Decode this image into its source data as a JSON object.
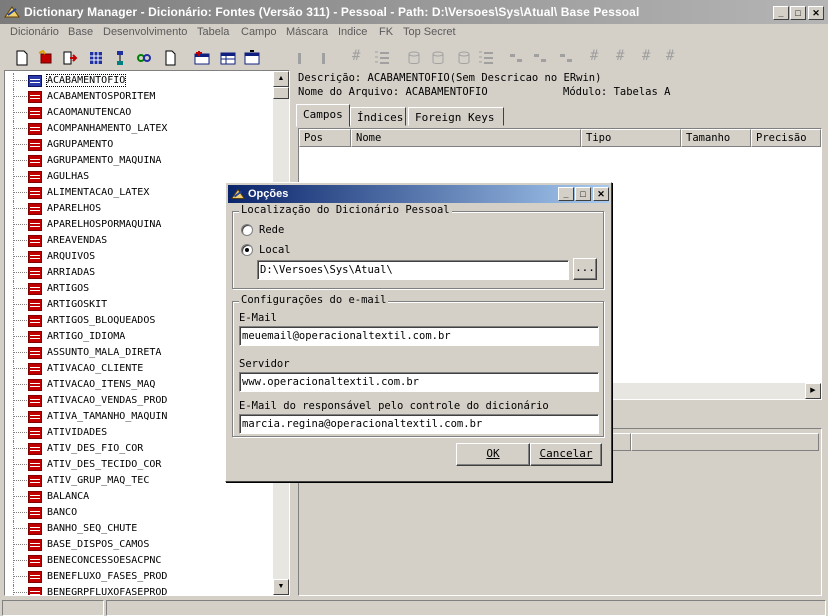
{
  "window": {
    "title": "Dictionary Manager - Dicionário: Fontes (Versão 311) - Pessoal - Path: D:\\Versoes\\Sys\\Atual\\ Base Pessoal",
    "icon": "dictionary-app-icon"
  },
  "menu": [
    {
      "label": "Dicionário"
    },
    {
      "label": "Base"
    },
    {
      "label": "Desenvolvimento"
    },
    {
      "label": "Tabela"
    },
    {
      "label": "Campo"
    },
    {
      "label": "Máscara"
    },
    {
      "label": "Indice"
    },
    {
      "label": "FK"
    },
    {
      "label": "Top Secret"
    }
  ],
  "toolbar": {
    "icons": [
      "new-document-icon",
      "open-table-icon",
      "export-icon",
      "grid-icon",
      "tree-icon",
      "link-icon",
      "page-icon",
      "add-table-icon",
      "table-icon",
      "edit-table-icon",
      "column-icon",
      "column-icon",
      "hash-list-icon",
      "database-icon",
      "database-icon",
      "database-icon",
      "sort-list-icon",
      "field-icon",
      "field-icon",
      "field-icon",
      "hash-icon",
      "hash-icon",
      "hash-icon",
      "hash-icon"
    ],
    "hash_glyph": "#"
  },
  "tree": {
    "items": [
      "ACABAMENTOFIO",
      "ACABAMENTOSPORITEM",
      "ACAOMANUTENCAO",
      "ACOMPANHAMENTO_LATEX",
      "AGRUPAMENTO",
      "AGRUPAMENTO_MAQUINA",
      "AGULHAS",
      "ALIMENTACAO_LATEX",
      "APARELHOS",
      "APARELHOSPORMAQUINA",
      "AREAVENDAS",
      "ARQUIVOS",
      "ARRIADAS",
      "ARTIGOS",
      "ARTIGOSKIT",
      "ARTIGOS_BLOQUEADOS",
      "ARTIGO_IDIOMA",
      "ASSUNTO_MALA_DIRETA",
      "ATIVACAO_CLIENTE",
      "ATIVACAO_ITENS_MAQ",
      "ATIVACAO_VENDAS_PROD",
      "ATIVA_TAMANHO_MAQUIN",
      "ATIVIDADES",
      "ATIV_DES_FIO_COR",
      "ATIV_DES_TECIDO_COR",
      "ATIV_GRUP_MAQ_TEC",
      "BALANCA",
      "BANCO",
      "BANHO_SEQ_CHUTE",
      "BASE_DISPOS_CAMOS",
      "BENECONCESSOESACPNC",
      "BENEFLUXO_FASES_PROD",
      "BENEGRPFLUXOFASEPROD"
    ],
    "selected_index": 0,
    "scroll_up": "▲",
    "scroll_down": "▼"
  },
  "info": {
    "descricao": "Descrição: ACABAMENTOFIO(Sem Descricao no ERwin)",
    "arquivo": "Nome do Arquivo: ACABAMENTOFIO",
    "modulo": "Módulo: Tabelas A"
  },
  "tabs": [
    {
      "label": "Campos",
      "active": true
    },
    {
      "label": "Índices",
      "active": false
    },
    {
      "label": "Foreign Keys",
      "active": false
    }
  ],
  "grid": {
    "columns": [
      "Pos",
      "Nome",
      "Tipo",
      "Tamanho",
      "Precisão"
    ],
    "scroll_right": "▶"
  },
  "dialog": {
    "title": "Opções",
    "group_local": {
      "label": "Localização do Dicionário Pessoal",
      "radio_rede": "Rede",
      "radio_local": "Local",
      "selected": "Local",
      "path_value": "D:\\Versoes\\Sys\\Atual\\",
      "browse_label": "..."
    },
    "group_email": {
      "label": "Configurações do e-mail",
      "email_label": "E-Mail",
      "email_value": "meuemail@operacionaltextil.com.br",
      "servidor_label": "Servidor",
      "servidor_value": "www.operacionaltextil.com.br",
      "responsavel_label": "E-Mail do responsável pelo controle do dicionário",
      "responsavel_value": "marcia.regina@operacionaltextil.com.br"
    },
    "ok_label": "OK",
    "cancel_label": "Cancelar"
  },
  "caption_buttons": {
    "minimize": "_",
    "maximize": "□",
    "close": "✕"
  }
}
